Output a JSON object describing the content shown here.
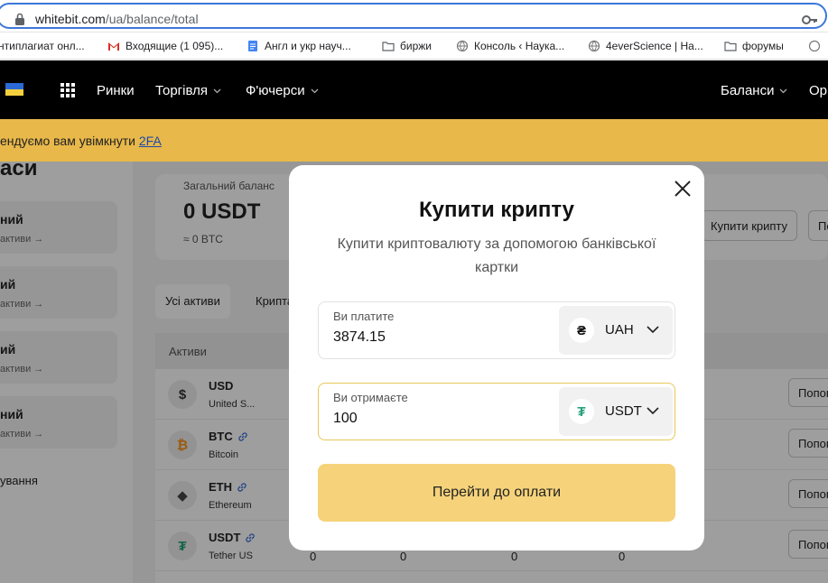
{
  "browser": {
    "url_domain": "whitebit.com",
    "url_path": "/ua/balance/total",
    "bookmarks": [
      {
        "label": "нтиплагиат онл...",
        "icon": "bookmark-generic-icon"
      },
      {
        "label": "Входящие (1 095)...",
        "icon": "gmail-icon"
      },
      {
        "label": "Англ и укр науч...",
        "icon": "docs-icon"
      },
      {
        "label": "биржи",
        "icon": "folder-icon"
      },
      {
        "label": "Консоль ‹ Наука...",
        "icon": "globe-icon"
      },
      {
        "label": "4everScience | На...",
        "icon": "globe-icon"
      },
      {
        "label": "форумы",
        "icon": "folder-icon"
      }
    ]
  },
  "nav": {
    "items": [
      "Ринки",
      "Торгівля",
      "Ф'ючерси"
    ],
    "balances": "Баланси",
    "orders_partial": "Ор"
  },
  "banner": {
    "text": "ендуємо вам увімкнути ",
    "link": "2FA"
  },
  "sidebar": {
    "title": "аси",
    "cards": [
      {
        "title": "ний",
        "sub": "активи →"
      },
      {
        "title": "ий",
        "sub": "активи →"
      },
      {
        "title": "ий",
        "sub": "активи →"
      },
      {
        "title": "ний",
        "sub": "активи →"
      }
    ],
    "bottom_link": "ування"
  },
  "balance": {
    "label": "Загальний баланс",
    "value": "0 USDT",
    "btc": "≈ 0 BTC",
    "buy_button": "Купити крипту",
    "second_button_partial": "По"
  },
  "filters": [
    "Усі активи",
    "Крипта"
  ],
  "assets_table": {
    "header": "Активи",
    "rows": [
      {
        "symbol": "USD",
        "name": "United S...",
        "glyph": "$",
        "color": "#333333",
        "link": false,
        "action": "Попов"
      },
      {
        "symbol": "BTC",
        "name": "Bitcoin",
        "glyph": "₿",
        "color": "#f7931a",
        "link": true,
        "action": "Попов"
      },
      {
        "symbol": "ETH",
        "name": "Ethereum",
        "glyph": "◆",
        "color": "#444444",
        "link": true,
        "action": "Попов"
      },
      {
        "symbol": "USDT",
        "name": "Tether US",
        "glyph": "₮",
        "color": "#26a17b",
        "link": true,
        "action": "Попов"
      }
    ],
    "zeros": [
      "0",
      "0",
      "0",
      "0"
    ]
  },
  "modal": {
    "title": "Купити крипту",
    "subtitle": "Купити криптовалюту за допомогою банківської картки",
    "pay_field": {
      "label": "Ви платите",
      "value": "3874.15",
      "currency": "UAH",
      "currency_glyph": "₴"
    },
    "receive_field": {
      "label": "Ви отримаєте",
      "value": "100",
      "currency": "USDT",
      "currency_glyph": "₮"
    },
    "submit": "Перейти до оплати"
  },
  "colors": {
    "accent": "#f6d37a",
    "banner": "#e8b84a",
    "nav_bg": "#000000",
    "tether": "#26a17b",
    "bitcoin": "#f7931a"
  }
}
